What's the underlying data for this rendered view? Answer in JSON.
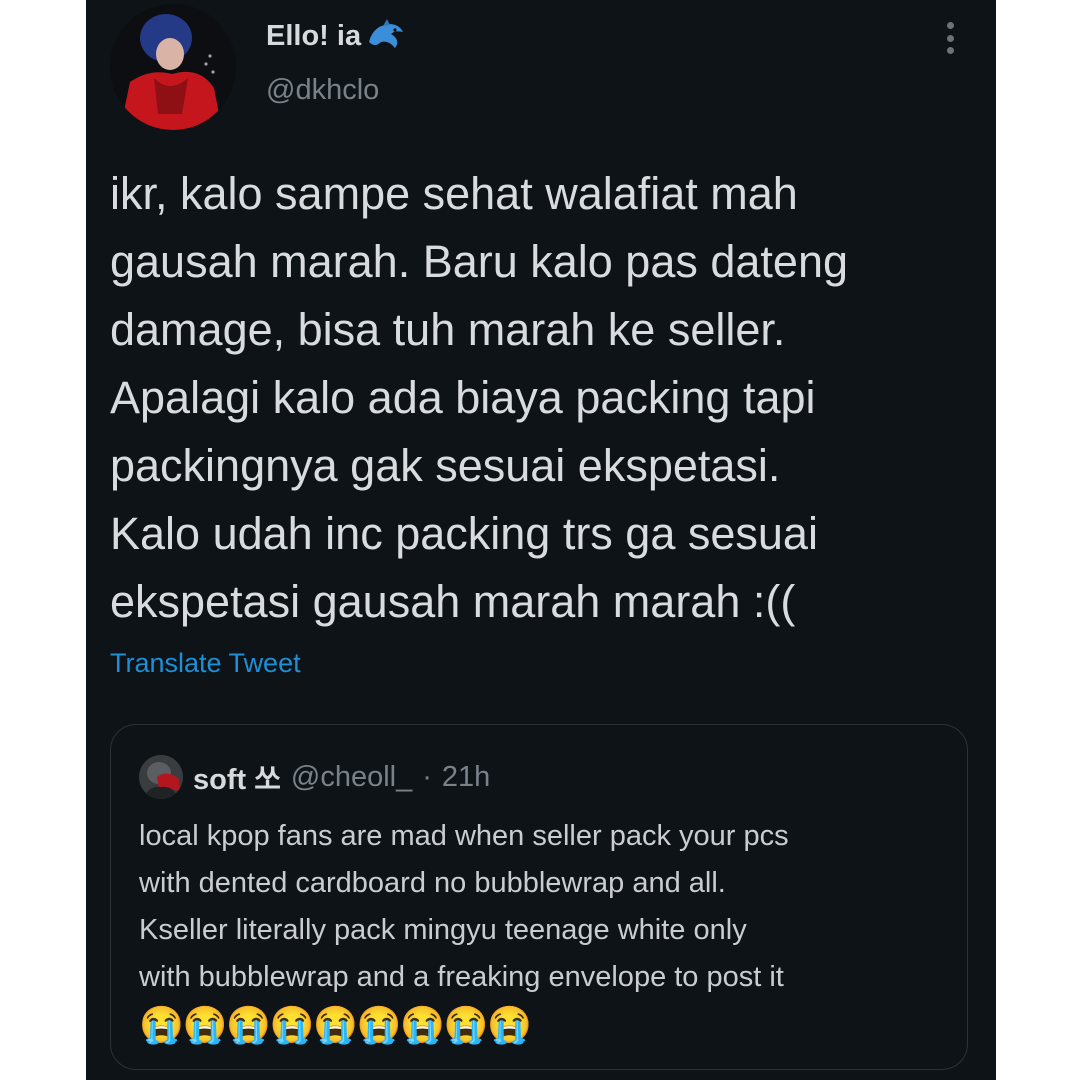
{
  "author": {
    "display_name": "Ello! ia",
    "name_emoji": "🐬",
    "handle": "@dkhclo",
    "avatar_icon": "profile-photo"
  },
  "tweet": {
    "lines": [
      "ikr, kalo sampe sehat walafiat mah",
      "gausah marah. Baru kalo pas dateng",
      "damage, bisa tuh marah ke seller.",
      "Apalagi kalo ada biaya packing tapi",
      "packingnya gak sesuai ekspetasi.",
      "Kalo udah inc packing trs ga sesuai",
      "ekspetasi gausah marah marah :(("
    ],
    "translate_label": "Translate Tweet"
  },
  "quoted": {
    "name": "soft 쏘",
    "handle": "@cheoll_",
    "separator": "·",
    "time": "21h",
    "lines": [
      "local kpop fans are mad when seller pack your pcs",
      "with dented cardboard no bubblewrap and all.",
      "Kseller literally pack mingyu teenage white only",
      "with bubblewrap and a freaking envelope to post it"
    ],
    "emojis": "😭😭😭😭😭😭😭😭😭"
  },
  "colors": {
    "background": "#0e1318",
    "text": "#d9dcdf",
    "muted": "#7a8289",
    "link": "#1d8fd6",
    "border": "#2c3238"
  }
}
